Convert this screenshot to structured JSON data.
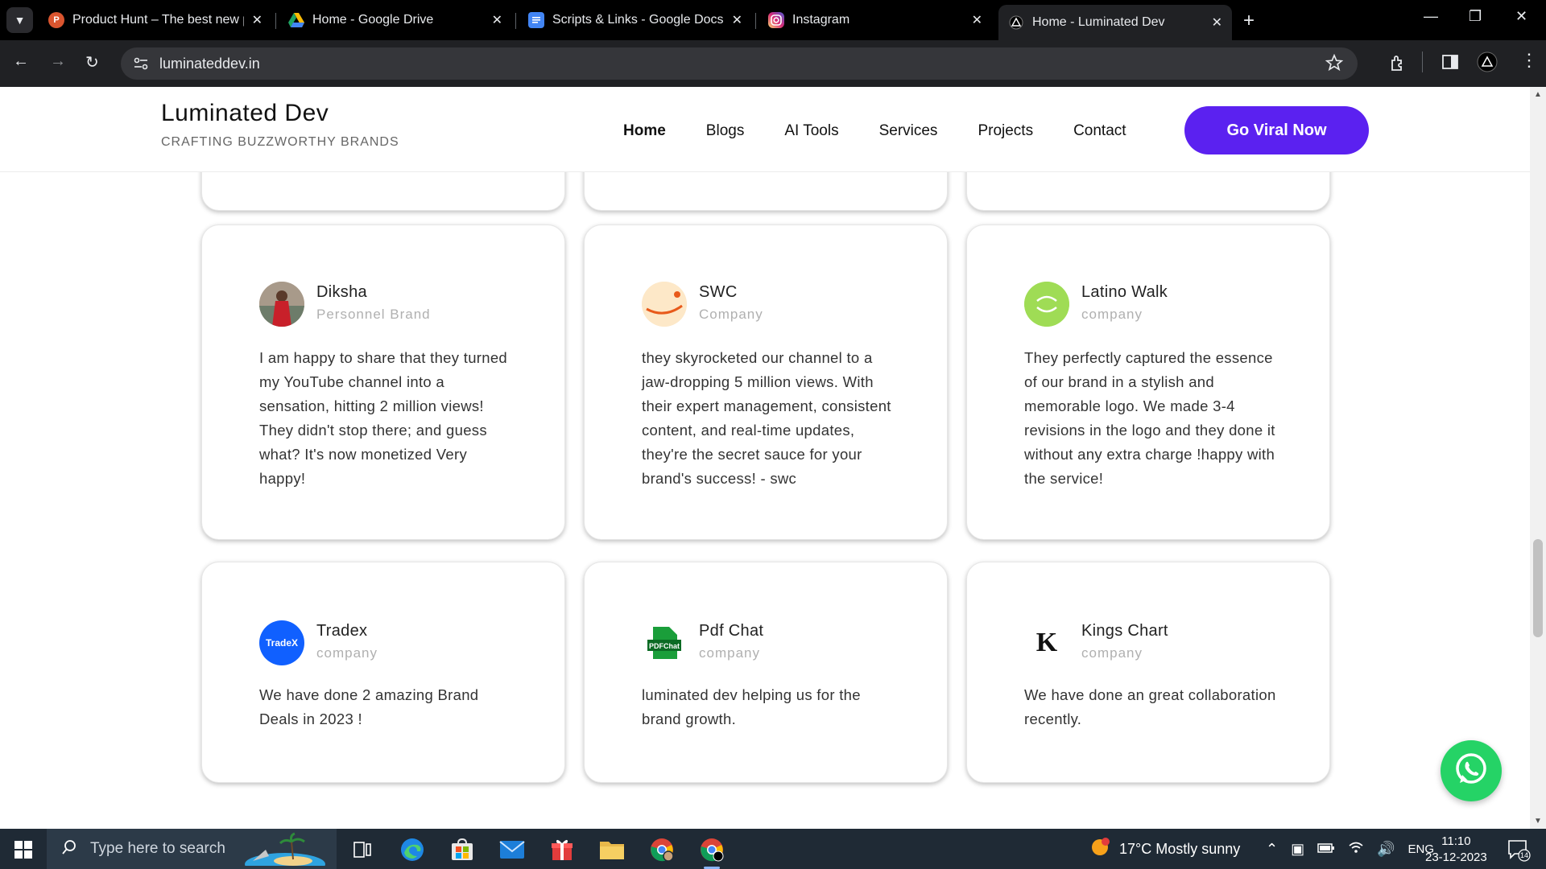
{
  "browser": {
    "tabs": [
      {
        "title": "Product Hunt – The best new products",
        "favicon": "product-hunt-icon",
        "color": "#da552f",
        "glyph": "P"
      },
      {
        "title": "Home - Google Drive",
        "favicon": "google-drive-icon",
        "color": "#1fa463",
        "glyph": ""
      },
      {
        "title": "Scripts & Links - Google Docs",
        "favicon": "google-docs-icon",
        "color": "#4285f4",
        "glyph": ""
      },
      {
        "title": "Instagram",
        "favicon": "instagram-icon",
        "color": "#d62976",
        "glyph": ""
      },
      {
        "title": "Home - Luminated Dev",
        "favicon": "luminated-dev-icon",
        "color": "#202124",
        "glyph": ""
      }
    ],
    "address": "luminateddev.in"
  },
  "site": {
    "brand_name": "Luminated Dev",
    "tagline": "CRAFTING BUZZWORTHY BRANDS",
    "nav": [
      "Home",
      "Blogs",
      "AI Tools",
      "Services",
      "Projects",
      "Contact"
    ],
    "cta_label": "Go Viral Now",
    "accent_color": "#5b21f0"
  },
  "testimonials": [
    {
      "name": "Diksha",
      "role": "Personnel Brand",
      "quote": "I am happy to share that they turned my YouTube channel into a sensation, hitting 2 million views! They didn't stop there; and guess what? It's now monetized Very happy!",
      "avatar": "diksha-avatar"
    },
    {
      "name": "SWC",
      "role": "Company",
      "quote": "they skyrocketed our channel to a jaw-dropping 5 million views. With their expert management, consistent content, and real-time updates, they're the secret sauce for your brand's success! - swc",
      "avatar": "swc-logo"
    },
    {
      "name": "Latino Walk",
      "role": "company",
      "quote": "They perfectly captured the essence of our brand in a stylish and memorable logo. We made 3-4 revisions in the logo and they done it without any extra charge !happy with the service!",
      "avatar": "latino-walk-logo"
    },
    {
      "name": "Tradex",
      "role": "company",
      "quote": "We have done 2 amazing Brand Deals in 2023 !",
      "avatar": "tradex-logo",
      "logo_text": "TradeX"
    },
    {
      "name": "Pdf Chat",
      "role": "company",
      "quote": "luminated dev helping us for the brand growth.",
      "avatar": "pdf-chat-logo",
      "logo_text": "PDFChat"
    },
    {
      "name": "Kings Chart",
      "role": "company",
      "quote": "We have done an great collaboration recently.",
      "avatar": "kings-chart-logo",
      "logo_text": "K"
    }
  ],
  "taskbar": {
    "search_placeholder": "Type here to search",
    "weather": "17°C  Mostly sunny",
    "language": "ENG",
    "time": "11:10",
    "date": "23-12-2023",
    "notifications": "14"
  }
}
